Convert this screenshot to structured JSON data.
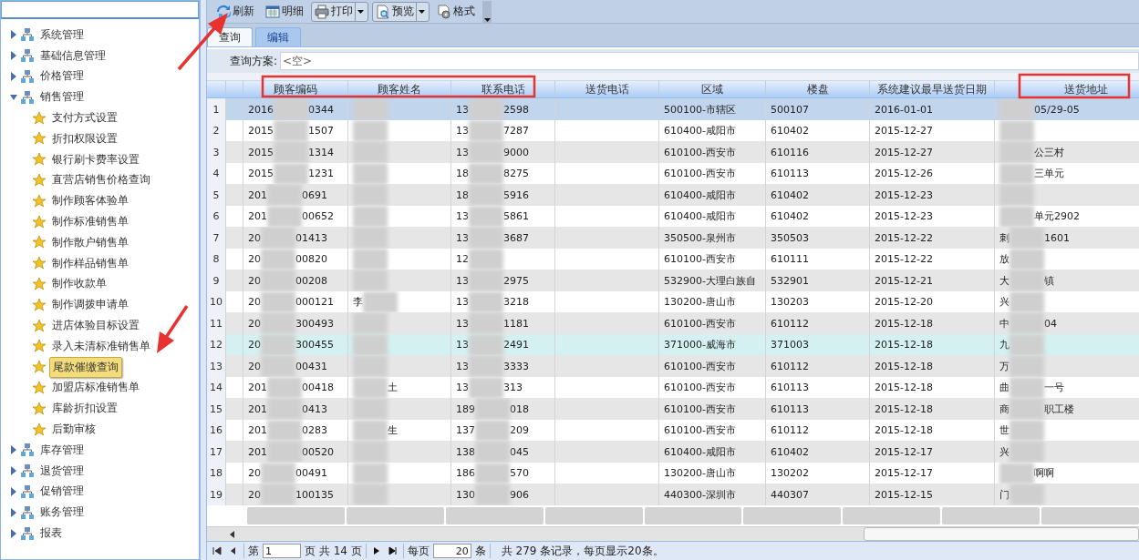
{
  "sidebar": {
    "tree": [
      {
        "label": "系统管理",
        "expanded": false,
        "selected": false
      },
      {
        "label": "基础信息管理",
        "expanded": false,
        "selected": false
      },
      {
        "label": "价格管理",
        "expanded": false,
        "selected": false
      },
      {
        "label": "销售管理",
        "expanded": true,
        "selected": false,
        "children": [
          {
            "label": "支付方式设置",
            "selected": false
          },
          {
            "label": "折扣权限设置",
            "selected": false
          },
          {
            "label": "银行刷卡费率设置",
            "selected": false
          },
          {
            "label": "直营店销售价格查询",
            "selected": false
          },
          {
            "label": "制作顾客体验单",
            "selected": false
          },
          {
            "label": "制作标准销售单",
            "selected": false
          },
          {
            "label": "制作散户销售单",
            "selected": false
          },
          {
            "label": "制作样品销售单",
            "selected": false
          },
          {
            "label": "制作收款单",
            "selected": false
          },
          {
            "label": "制作调拨申请单",
            "selected": false
          },
          {
            "label": "进店体验目标设置",
            "selected": false
          },
          {
            "label": "录入未清标准销售单",
            "selected": false
          },
          {
            "label": "尾款催缴查询",
            "selected": true
          },
          {
            "label": "加盟店标准销售单",
            "selected": false
          },
          {
            "label": "库龄折扣设置",
            "selected": false
          },
          {
            "label": "后勤审核",
            "selected": false
          }
        ]
      },
      {
        "label": "库存管理",
        "expanded": false,
        "selected": false
      },
      {
        "label": "退货管理",
        "expanded": false,
        "selected": false
      },
      {
        "label": "促销管理",
        "expanded": false,
        "selected": false
      },
      {
        "label": "账务管理",
        "expanded": false,
        "selected": false
      },
      {
        "label": "报表",
        "expanded": false,
        "selected": false
      }
    ]
  },
  "toolbar": [
    {
      "label": "刷新",
      "kind": "plain"
    },
    {
      "label": "明细",
      "kind": "plain"
    },
    {
      "label": "打印",
      "kind": "split"
    },
    {
      "label": "预览",
      "kind": "split"
    },
    {
      "label": "格式",
      "kind": "plain"
    }
  ],
  "tabs": [
    {
      "label": "查询",
      "selected": true
    },
    {
      "label": "编辑",
      "selected": false
    }
  ],
  "query": {
    "label": "查询方案:",
    "value": "<空>"
  },
  "table": {
    "columns": [
      "顾客编码",
      "顾客姓名",
      "联系电话",
      "送货电话",
      "区域",
      "楼盘",
      "系统建议最早送货日期",
      "送货地址"
    ],
    "rows": [
      {
        "no": "1",
        "selected": true,
        "highlighted": false,
        "cells": [
          {
            "kind": "redacted",
            "before": "2016",
            "after": "0344"
          },
          {
            "kind": "redacted"
          },
          {
            "kind": "redacted",
            "before": "13",
            "after": "2598"
          },
          null,
          "500100-市辖区",
          "500107",
          "2016-01-01",
          {
            "kind": "redacted",
            "after": "05/29-05"
          }
        ]
      },
      {
        "no": "2",
        "selected": false,
        "highlighted": false,
        "cells": [
          {
            "kind": "redacted",
            "before": "2015",
            "after": "1507"
          },
          {
            "kind": "redacted"
          },
          {
            "kind": "redacted",
            "before": "13",
            "after": "7287"
          },
          null,
          "610400-咸阳市",
          "610402",
          "2015-12-27",
          {
            "kind": "redacted"
          }
        ]
      },
      {
        "no": "3",
        "selected": false,
        "highlighted": false,
        "cells": [
          {
            "kind": "redacted",
            "before": "2015",
            "after": "1314"
          },
          {
            "kind": "redacted"
          },
          {
            "kind": "redacted",
            "before": "13",
            "after": "9000"
          },
          null,
          "610100-西安市",
          "610116",
          "2015-12-27",
          {
            "kind": "redacted",
            "after": "公三村"
          }
        ]
      },
      {
        "no": "4",
        "selected": false,
        "highlighted": false,
        "cells": [
          {
            "kind": "redacted",
            "before": "2015",
            "after": "1231"
          },
          {
            "kind": "redacted"
          },
          {
            "kind": "redacted",
            "before": "18",
            "after": "8275"
          },
          null,
          "610100-西安市",
          "610113",
          "2015-12-26",
          {
            "kind": "redacted",
            "after": "三单元"
          }
        ]
      },
      {
        "no": "5",
        "selected": false,
        "highlighted": false,
        "cells": [
          {
            "kind": "redacted",
            "before": "201",
            "after": "0691"
          },
          {
            "kind": "redacted"
          },
          {
            "kind": "redacted",
            "before": "18",
            "after": "5916"
          },
          null,
          "610400-咸阳市",
          "610402",
          "2015-12-23",
          {
            "kind": "redacted"
          }
        ]
      },
      {
        "no": "6",
        "selected": false,
        "highlighted": false,
        "cells": [
          {
            "kind": "redacted",
            "before": "201",
            "after": "00652"
          },
          {
            "kind": "redacted"
          },
          {
            "kind": "redacted",
            "before": "13",
            "after": "5861"
          },
          null,
          "610400-咸阳市",
          "610402",
          "2015-12-23",
          {
            "kind": "redacted",
            "after": "单元2902"
          }
        ]
      },
      {
        "no": "7",
        "selected": false,
        "highlighted": false,
        "cells": [
          {
            "kind": "redacted",
            "before": "20",
            "after": "01413"
          },
          {
            "kind": "redacted"
          },
          {
            "kind": "redacted",
            "before": "13",
            "after": "3687"
          },
          null,
          "350500-泉州市",
          "350503",
          "2015-12-22",
          {
            "kind": "redacted",
            "before": "刺",
            "after": "1601"
          }
        ]
      },
      {
        "no": "8",
        "selected": false,
        "highlighted": false,
        "cells": [
          {
            "kind": "redacted",
            "before": "20",
            "after": "00820"
          },
          {
            "kind": "redacted"
          },
          {
            "kind": "redacted",
            "before": "12"
          },
          null,
          "610100-西安市",
          "610111",
          "2015-12-22",
          {
            "kind": "redacted",
            "before": "放"
          }
        ]
      },
      {
        "no": "9",
        "selected": false,
        "highlighted": false,
        "cells": [
          {
            "kind": "redacted",
            "before": "20",
            "after": "00208"
          },
          {
            "kind": "redacted"
          },
          {
            "kind": "redacted",
            "before": "13",
            "after": "2975"
          },
          null,
          "532900-大理白族自",
          "532901",
          "2015-12-21",
          {
            "kind": "redacted",
            "before": "大",
            "after": "镇"
          }
        ]
      },
      {
        "no": "10",
        "selected": false,
        "highlighted": false,
        "cells": [
          {
            "kind": "redacted",
            "before": "20",
            "after": "000121"
          },
          {
            "kind": "redacted",
            "before": "李"
          },
          {
            "kind": "redacted",
            "before": "13",
            "after": "3218"
          },
          null,
          "130200-唐山市",
          "130203",
          "2015-12-20",
          {
            "kind": "redacted",
            "before": "兴"
          }
        ]
      },
      {
        "no": "11",
        "selected": false,
        "highlighted": false,
        "cells": [
          {
            "kind": "redacted",
            "before": "20",
            "after": "300493"
          },
          {
            "kind": "redacted"
          },
          {
            "kind": "redacted",
            "before": "13",
            "after": "1181"
          },
          null,
          "610100-西安市",
          "610112",
          "2015-12-18",
          {
            "kind": "redacted",
            "before": "中",
            "after": "04"
          }
        ]
      },
      {
        "no": "12",
        "selected": false,
        "highlighted": true,
        "cells": [
          {
            "kind": "redacted",
            "before": "20",
            "after": "300455"
          },
          {
            "kind": "redacted"
          },
          {
            "kind": "redacted",
            "before": "13",
            "after": "2491"
          },
          null,
          "371000-威海市",
          "371003",
          "2015-12-18",
          {
            "kind": "redacted",
            "before": "九"
          }
        ]
      },
      {
        "no": "13",
        "selected": false,
        "highlighted": false,
        "cells": [
          {
            "kind": "redacted",
            "before": "20",
            "after": "00431"
          },
          {
            "kind": "redacted"
          },
          {
            "kind": "redacted",
            "before": "13",
            "after": "3333"
          },
          null,
          "610100-西安市",
          "610112",
          "2015-12-18",
          {
            "kind": "redacted",
            "before": "万"
          }
        ]
      },
      {
        "no": "14",
        "selected": false,
        "highlighted": false,
        "cells": [
          {
            "kind": "redacted",
            "before": "201",
            "after": "00418"
          },
          {
            "kind": "redacted",
            "after": "土"
          },
          {
            "kind": "redacted",
            "before": "13",
            "after": "313"
          },
          null,
          "610100-西安市",
          "610113",
          "2015-12-18",
          {
            "kind": "redacted",
            "before": "曲",
            "after": "一号"
          }
        ]
      },
      {
        "no": "15",
        "selected": false,
        "highlighted": false,
        "cells": [
          {
            "kind": "redacted",
            "before": "201",
            "after": "0413"
          },
          {
            "kind": "redacted"
          },
          {
            "kind": "redacted",
            "before": "189",
            "after": "018"
          },
          null,
          "610100-西安市",
          "610113",
          "2015-12-18",
          {
            "kind": "redacted",
            "before": "商",
            "after": "职工楼"
          }
        ]
      },
      {
        "no": "16",
        "selected": false,
        "highlighted": false,
        "cells": [
          {
            "kind": "redacted",
            "before": "201",
            "after": "0283"
          },
          {
            "kind": "redacted",
            "after": "生"
          },
          {
            "kind": "redacted",
            "before": "137",
            "after": "209"
          },
          null,
          "610100-西安市",
          "610112",
          "2015-12-18",
          {
            "kind": "redacted",
            "before": "世"
          }
        ]
      },
      {
        "no": "17",
        "selected": false,
        "highlighted": false,
        "cells": [
          {
            "kind": "redacted",
            "before": "201",
            "after": "00520"
          },
          {
            "kind": "redacted"
          },
          {
            "kind": "redacted",
            "before": "138",
            "after": "045"
          },
          null,
          "610400-咸阳市",
          "610402",
          "2015-12-17",
          {
            "kind": "redacted",
            "before": "兴"
          }
        ]
      },
      {
        "no": "18",
        "selected": false,
        "highlighted": false,
        "cells": [
          {
            "kind": "redacted",
            "before": "20",
            "after": "00491"
          },
          {
            "kind": "redacted"
          },
          {
            "kind": "redacted",
            "before": "186",
            "after": "570"
          },
          null,
          "130200-唐山市",
          "130202",
          "2015-12-17",
          {
            "kind": "redacted",
            "after": "啊啊"
          }
        ]
      },
      {
        "no": "19",
        "selected": false,
        "highlighted": false,
        "cells": [
          {
            "kind": "redacted",
            "before": "20",
            "after": "100135"
          },
          {
            "kind": "redacted"
          },
          {
            "kind": "redacted",
            "before": "130",
            "after": "906"
          },
          null,
          "440300-深圳市",
          "440307",
          "2015-12-15",
          {
            "kind": "redacted",
            "before": "门"
          }
        ]
      }
    ]
  },
  "pager": {
    "page_prefix": "第",
    "page": "1",
    "page_suffix": "页 共 14 页",
    "size_prefix": "每页",
    "size": "20",
    "size_suffix": "条",
    "summary": "共 279 条记录，每页显示20条。"
  }
}
